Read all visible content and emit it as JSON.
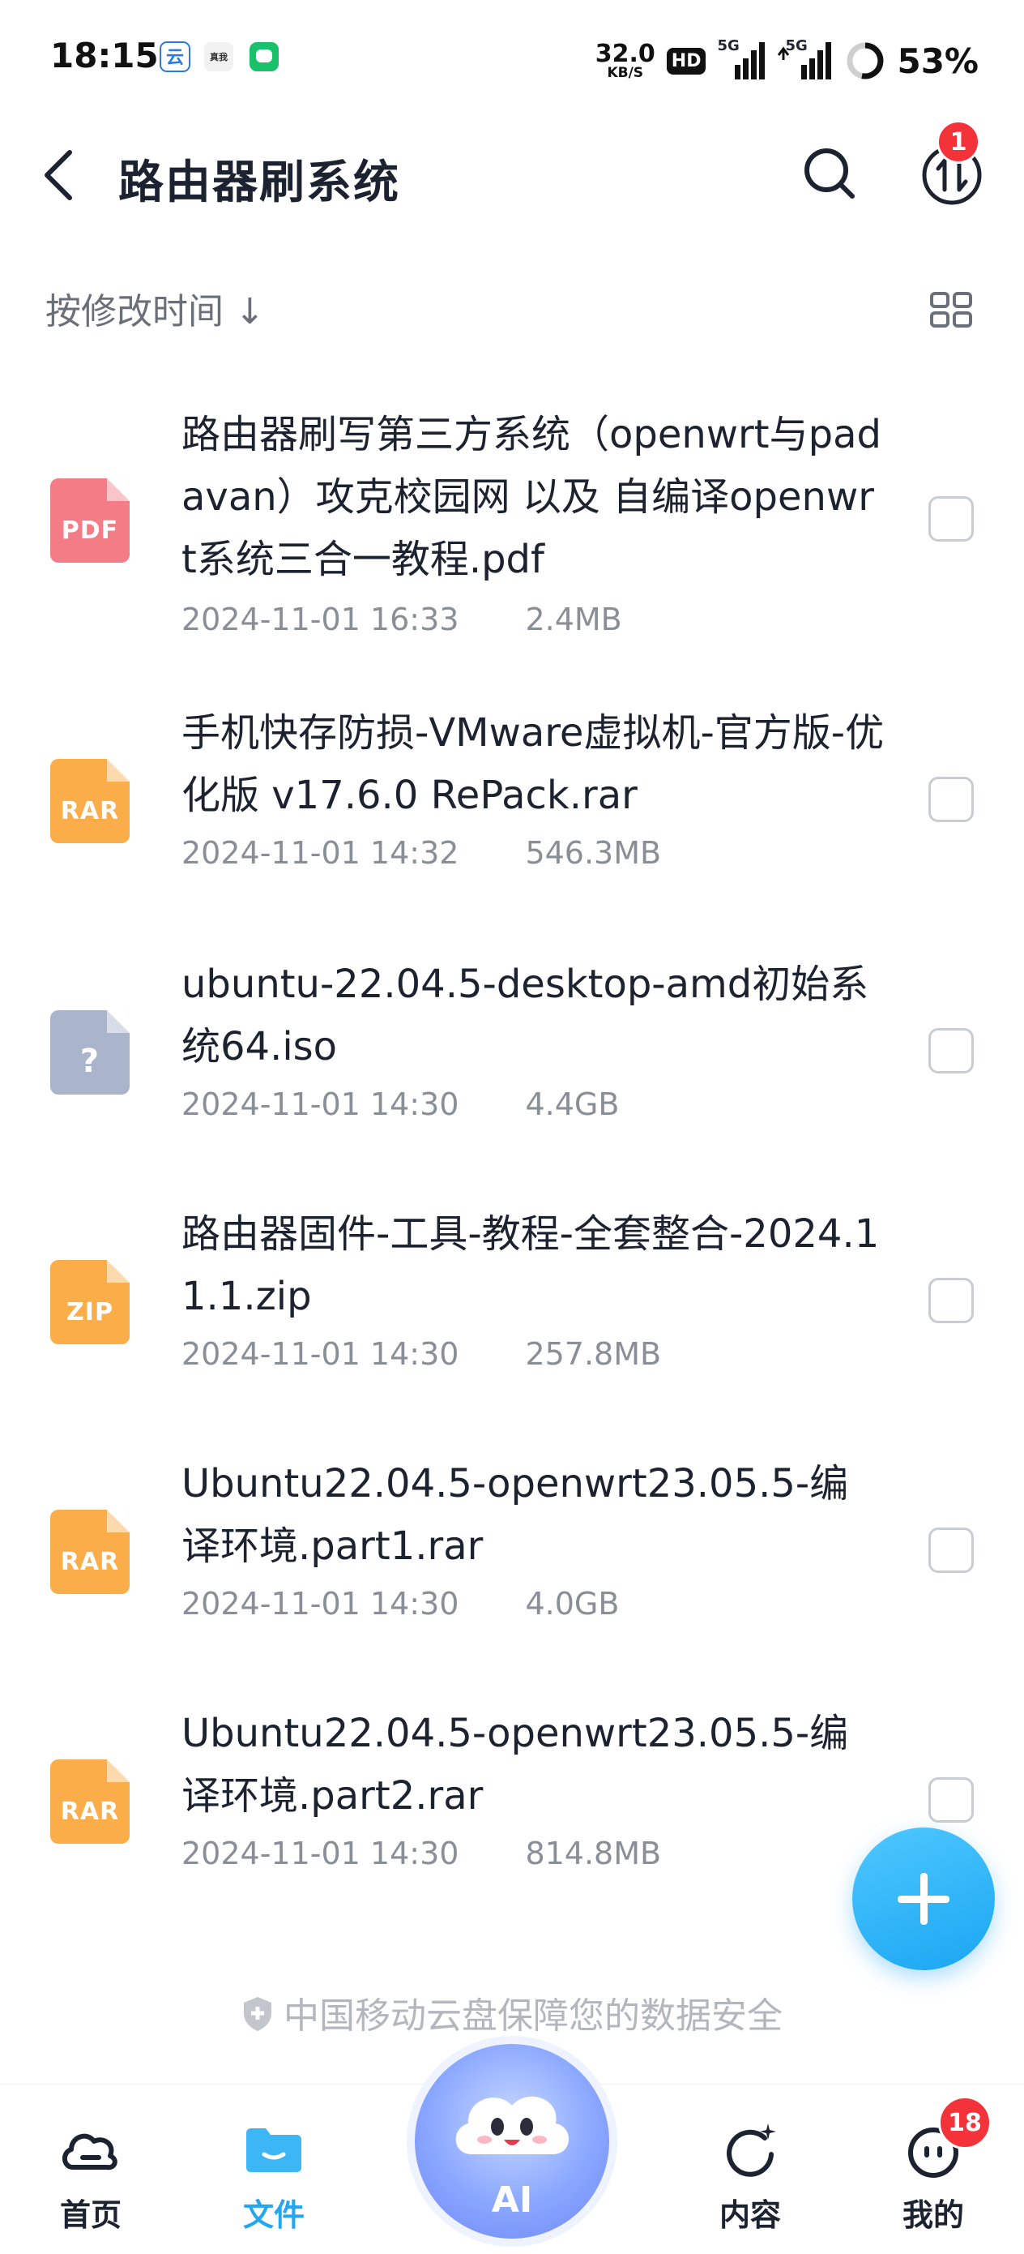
{
  "status_bar": {
    "time": "18:15",
    "net_speed_value": "32.0",
    "net_speed_unit": "KB/S",
    "hd_label": "HD",
    "signal_1_label": "5G",
    "signal_2_label": "5G",
    "battery_percent": "53%",
    "app_icons": [
      "cloud-app-icon",
      "realme-app-icon",
      "chat-app-icon"
    ]
  },
  "header": {
    "title": "路由器刷系统",
    "transfer_badge": "1"
  },
  "sort": {
    "label": "按修改时间 ↓"
  },
  "files": [
    {
      "name": "路由器刷写第三方系统（openwrt与padavan）攻克校园网 以及 自编译openwrt系统三合一教程.pdf",
      "date": "2024-11-01 16:33",
      "size": "2.4MB",
      "type": "PDF",
      "color": "#f47c86"
    },
    {
      "name": "手机快存防损-VMware虚拟机-官方版-优化版 v17.6.0 RePack.rar",
      "date": "2024-11-01 14:32",
      "size": "546.3MB",
      "type": "RAR",
      "color": "#fbad4a"
    },
    {
      "name": "ubuntu-22.04.5-desktop-amd初始系统64.iso",
      "date": "2024-11-01 14:30",
      "size": "4.4GB",
      "type": "?",
      "color": "#aab4ca"
    },
    {
      "name": "路由器固件-工具-教程-全套整合-2024.11.1.zip",
      "date": "2024-11-01 14:30",
      "size": "257.8MB",
      "type": "ZIP",
      "color": "#fbad4a"
    },
    {
      "name": "Ubuntu22.04.5-openwrt23.05.5-编译环境.part1.rar",
      "date": "2024-11-01 14:30",
      "size": "4.0GB",
      "type": "RAR",
      "color": "#fbad4a"
    },
    {
      "name": "Ubuntu22.04.5-openwrt23.05.5-编译环境.part2.rar",
      "date": "2024-11-01 14:30",
      "size": "814.8MB",
      "type": "RAR",
      "color": "#fbad4a"
    }
  ],
  "footer_note": "中国移动云盘保障您的数据安全",
  "bottom_nav": {
    "items": [
      {
        "label": "首页",
        "icon": "cloud-home-icon",
        "active": false
      },
      {
        "label": "文件",
        "icon": "folder-icon",
        "active": true
      },
      {
        "label": "AI",
        "icon": "ai-cloud-mascot-icon",
        "active": false
      },
      {
        "label": "内容",
        "icon": "content-refresh-icon",
        "active": false
      },
      {
        "label": "我的",
        "icon": "profile-icon",
        "active": false
      }
    ],
    "profile_badge": "18"
  },
  "colors": {
    "accent": "#21a7f0",
    "badge": "#f4323a"
  }
}
